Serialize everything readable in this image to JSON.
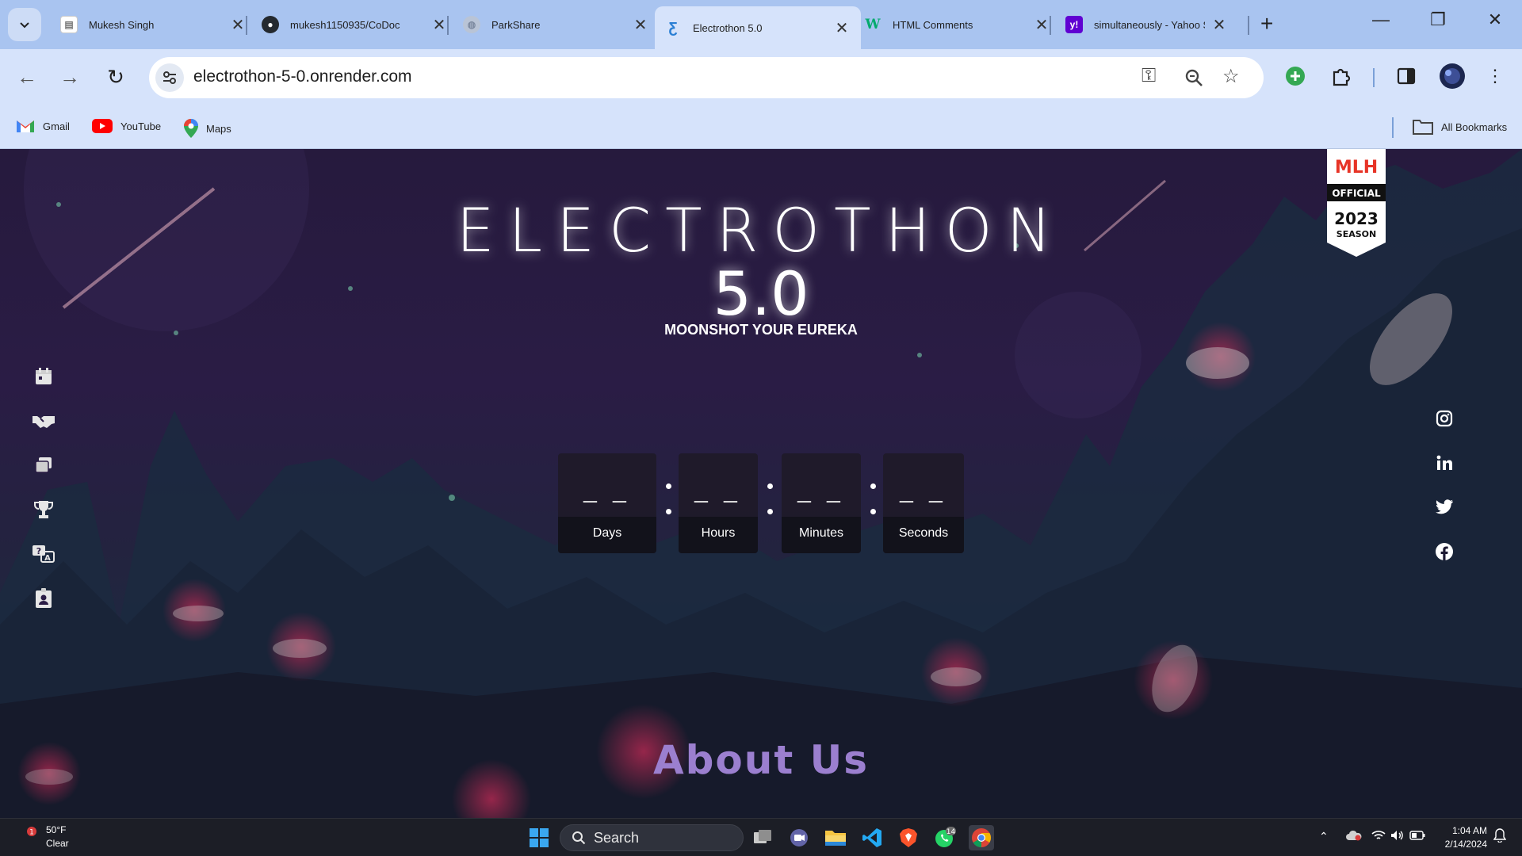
{
  "browser": {
    "tabs": [
      {
        "title": "Mukesh Singh",
        "favicon": "doc-icon",
        "active": false
      },
      {
        "title": "mukesh1150935/CoDoc",
        "favicon": "github-icon",
        "active": false
      },
      {
        "title": "ParkShare",
        "favicon": "globe-icon",
        "active": false
      },
      {
        "title": "Electrothon 5.0",
        "favicon": "electrothon-icon",
        "active": true
      },
      {
        "title": "HTML Comments",
        "favicon": "w3schools-icon",
        "active": false
      },
      {
        "title": "simultaneously - Yahoo Se",
        "favicon": "yahoo-icon",
        "active": false
      }
    ],
    "url": "electrothon-5-0.onrender.com",
    "bookmarks": [
      {
        "label": "Gmail",
        "icon": "gmail-icon"
      },
      {
        "label": "YouTube",
        "icon": "youtube-icon"
      },
      {
        "label": "Maps",
        "icon": "maps-icon"
      }
    ],
    "all_bookmarks": "All Bookmarks"
  },
  "page": {
    "title": "ELECTROTHON",
    "version": "5.0",
    "tagline": "MOONSHOT YOUR EUREKA",
    "badge": {
      "brand": "MLH",
      "line1": "OFFICIAL",
      "line2": "2023",
      "line3": "SEASON"
    },
    "countdown": [
      {
        "value": "_ _",
        "label": "Days"
      },
      {
        "value": "_ _",
        "label": "Hours"
      },
      {
        "value": "_ _",
        "label": "Minutes"
      },
      {
        "value": "_ _",
        "label": "Seconds"
      }
    ],
    "about_heading": "About Us",
    "left_nav_icons": [
      "calendar-icon",
      "handshake-icon",
      "gallery-icon",
      "trophy-icon",
      "faq-icon",
      "contact-card-icon"
    ],
    "social_icons": [
      "instagram-icon",
      "linkedin-icon",
      "twitter-icon",
      "facebook-icon"
    ]
  },
  "taskbar": {
    "weather_temp": "50°F",
    "weather_desc": "Clear",
    "weather_badge": "1",
    "search_label": "Search",
    "whatsapp_badge": "14",
    "time": "1:04 AM",
    "date": "2/14/2024"
  },
  "colors": {
    "tabstrip": "#a9c4f0",
    "toolbar": "#d6e3fb",
    "about_heading": "#9b7fcf",
    "page_bg": "#261a3d"
  }
}
